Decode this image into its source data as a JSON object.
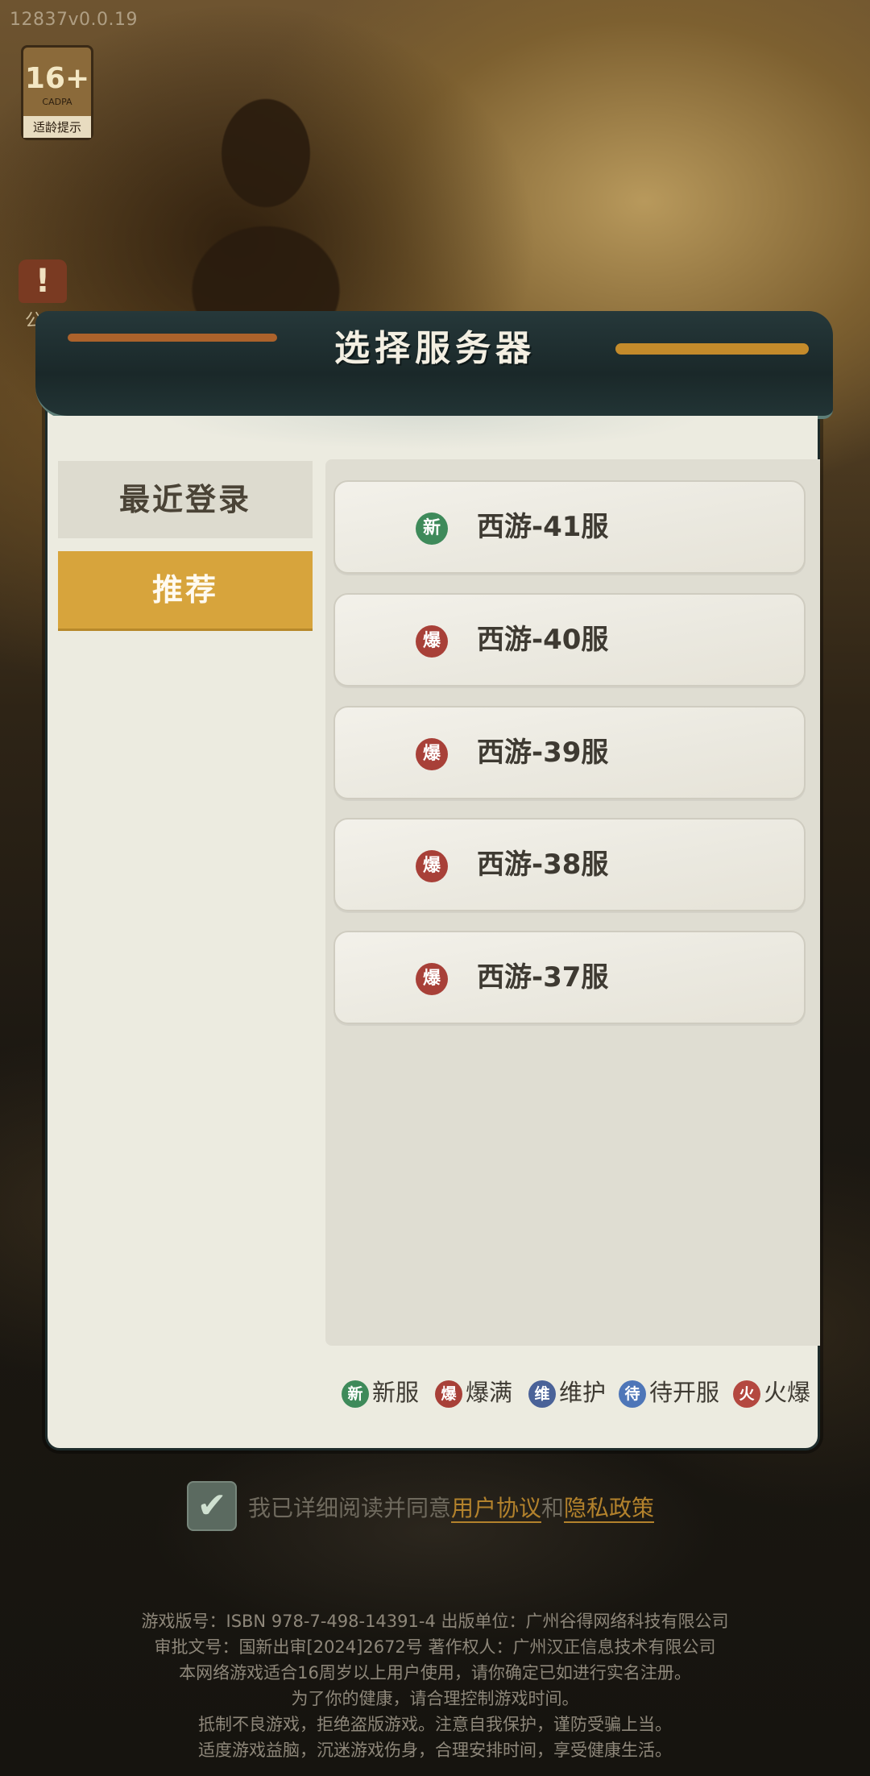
{
  "version": "12837v0.0.19",
  "age_badge": {
    "rating": "16+",
    "org": "CADPA",
    "label": "适龄提示"
  },
  "notice": {
    "icon": "exclamation-icon",
    "label": "公告"
  },
  "dialog": {
    "title": "选择服务器",
    "tabs": [
      {
        "label": "最近登录",
        "active": false
      },
      {
        "label": "推荐",
        "active": true
      }
    ],
    "servers": [
      {
        "name": "西游-41服",
        "status": "新",
        "status_type": "new"
      },
      {
        "name": "西游-40服",
        "status": "爆",
        "status_type": "full"
      },
      {
        "name": "西游-39服",
        "status": "爆",
        "status_type": "full"
      },
      {
        "name": "西游-38服",
        "status": "爆",
        "status_type": "full"
      },
      {
        "name": "西游-37服",
        "status": "爆",
        "status_type": "full"
      }
    ],
    "legend": [
      {
        "icon": "新",
        "label": "新服",
        "color": "#3e8a5a"
      },
      {
        "icon": "爆",
        "label": "爆满",
        "color": "#a84038"
      },
      {
        "icon": "维",
        "label": "维护",
        "color": "#4a6298"
      },
      {
        "icon": "待",
        "label": "待开服",
        "color": "#4e76b8"
      },
      {
        "icon": "火",
        "label": "火爆",
        "color": "#b44840"
      }
    ]
  },
  "agreement": {
    "checked": true,
    "prefix": "我已详细阅读并同意",
    "link1": "用户协议",
    "conj": "和",
    "link2": "隐私政策"
  },
  "footer": [
    "游戏版号：ISBN 978-7-498-14391-4  出版单位：广州谷得网络科技有限公司",
    "审批文号：国新出审[2024]2672号  著作权人：广州汉正信息技术有限公司",
    "本网络游戏适合16周岁以上用户使用，请你确定已如进行实名注册。",
    "为了你的健康，请合理控制游戏时间。",
    "抵制不良游戏，拒绝盗版游戏。注意自我保护，谨防受骗上当。",
    "适度游戏益脑，沉迷游戏伤身，合理安排时间，享受健康生活。"
  ]
}
